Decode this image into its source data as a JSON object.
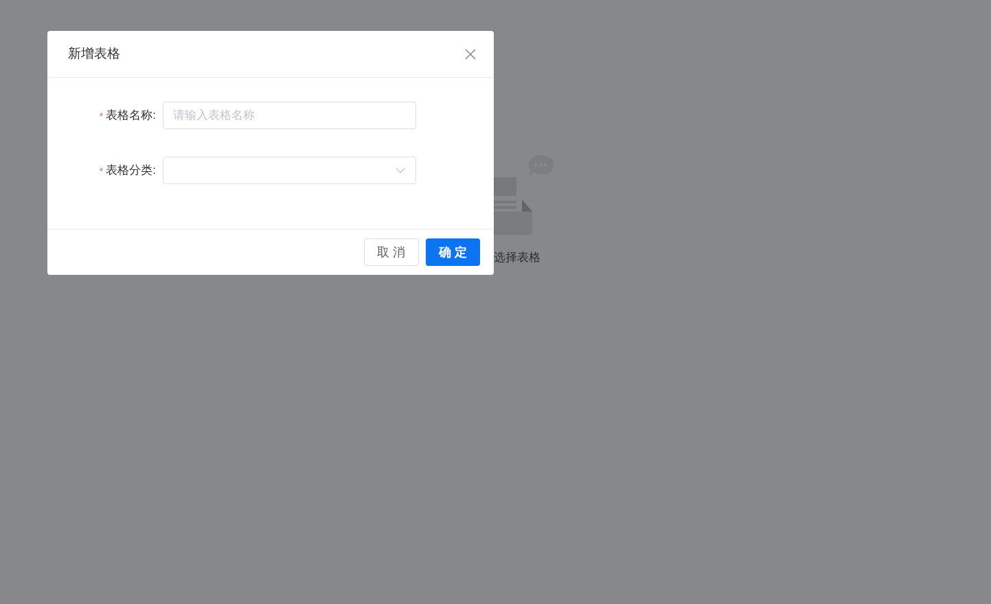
{
  "background": {
    "empty_state_text": "选择表格"
  },
  "dialog": {
    "title": "新增表格",
    "fields": [
      {
        "kind": "text",
        "required_mark": "*",
        "label": "表格名称:",
        "placeholder": "请输入表格名称"
      },
      {
        "kind": "select",
        "required_mark": "*",
        "label": "表格分类:"
      }
    ],
    "buttons": [
      {
        "kind": "default",
        "label": "取 消"
      },
      {
        "kind": "primary",
        "label": "确 定"
      }
    ]
  }
}
